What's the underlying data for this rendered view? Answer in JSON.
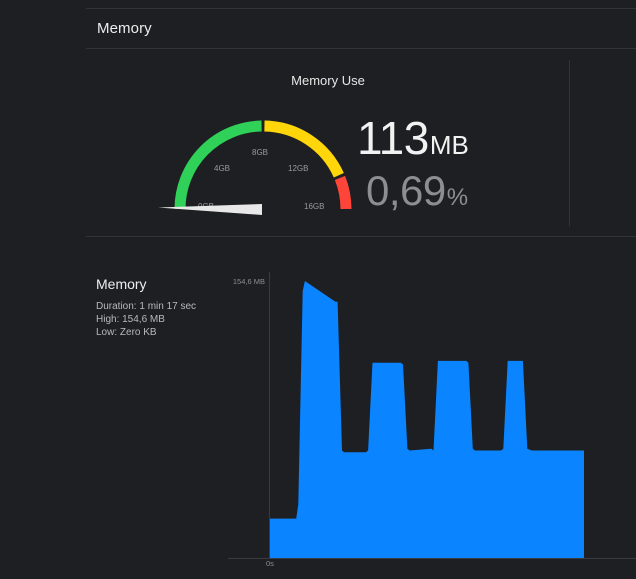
{
  "section": {
    "title": "Memory"
  },
  "gauge": {
    "title": "Memory Use",
    "value": "113",
    "unit": "MB",
    "percent": "0,69",
    "percent_symbol": "%",
    "ticks": [
      "0GB",
      "4GB",
      "8GB",
      "12GB",
      "16GB"
    ],
    "colors": {
      "green": "#30d158",
      "yellow": "#ffd60a",
      "red": "#ff453a",
      "needle": "#e8e8e8"
    }
  },
  "graph": {
    "title": "Memory",
    "duration": "Duration: 1 min 17 sec",
    "high": "High: 154,6 MB",
    "low": "Low: Zero KB",
    "y_label": "154,6 MB",
    "x_label": "0s",
    "fill_color": "#0a84ff"
  },
  "chart_data": {
    "type": "area",
    "x": [
      0,
      6,
      6.5,
      7.5,
      8,
      15,
      15.5,
      16.5,
      17,
      22,
      22.5,
      23.5,
      24,
      30,
      30.5,
      31.5,
      32,
      37,
      37.5,
      38.5,
      39,
      45,
      45.5,
      46.5,
      47,
      53,
      53.5,
      54.5,
      55,
      58,
      59,
      60,
      66,
      72
    ],
    "values": [
      22,
      22,
      30,
      149,
      154.6,
      143,
      143,
      60,
      59,
      59,
      60,
      109,
      109,
      109,
      108,
      61,
      60,
      61,
      60,
      110,
      110,
      110,
      109,
      61,
      60,
      60,
      61,
      110,
      110,
      110,
      61,
      60,
      60,
      60
    ],
    "xlabel": "",
    "ylabel": "",
    "ylim": [
      0,
      154.6
    ],
    "x_tick_labels": [
      "0s"
    ],
    "y_tick_labels": [
      "154,6 MB"
    ]
  }
}
